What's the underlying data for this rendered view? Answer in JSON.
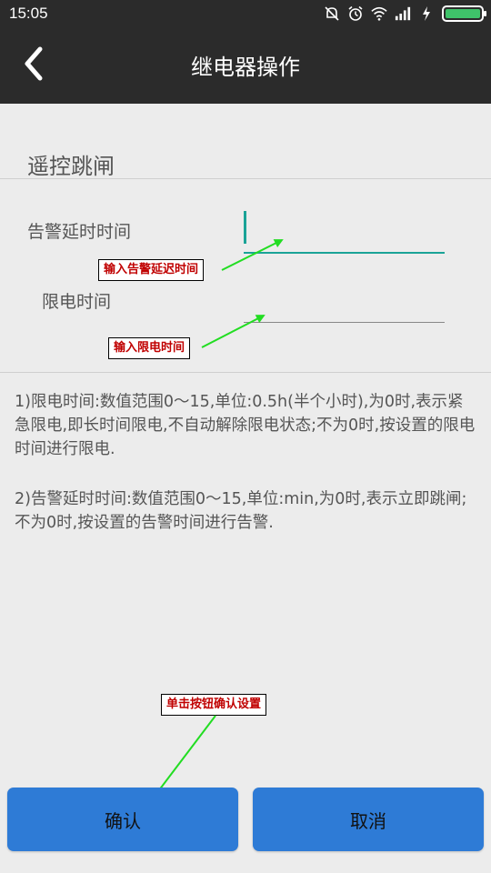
{
  "status_bar": {
    "time": "15:05",
    "icons": [
      "mute-icon",
      "alarm-icon",
      "wifi-icon",
      "signal-icon",
      "charging-icon",
      "battery-icon"
    ]
  },
  "toolbar": {
    "back_icon": "back-chevron-icon",
    "title": "继电器操作"
  },
  "section": {
    "title": "遥控跳闸"
  },
  "fields": {
    "alarm_delay": {
      "label": "告警延时时间",
      "value": ""
    },
    "power_limit": {
      "label": "限电时间",
      "value": ""
    }
  },
  "notes": {
    "note1": "1)限电时间:数值范围0～15,单位:0.5h(半个小时),为0时,表示紧急限电,即长时间限电,不自动解除限电状态;不为0时,按设置的限电时间进行限电.",
    "note2": "2)告警延时时间:数值范围0～15,单位:min,为0时,表示立即跳闸;不为0时,按设置的告警时间进行告警."
  },
  "annotations": {
    "alarm_hint": "输入告警延迟时间",
    "limit_hint": "输入限电时间",
    "confirm_hint": "单击按钮确认设置"
  },
  "buttons": {
    "confirm": "确认",
    "cancel": "取消"
  },
  "colors": {
    "toolbar_bg": "#2b2b2b",
    "accent_teal": "#1aa397",
    "button_blue": "#2e7bd6",
    "annotation_text": "#c00000",
    "arrow_green": "#22dd22"
  }
}
